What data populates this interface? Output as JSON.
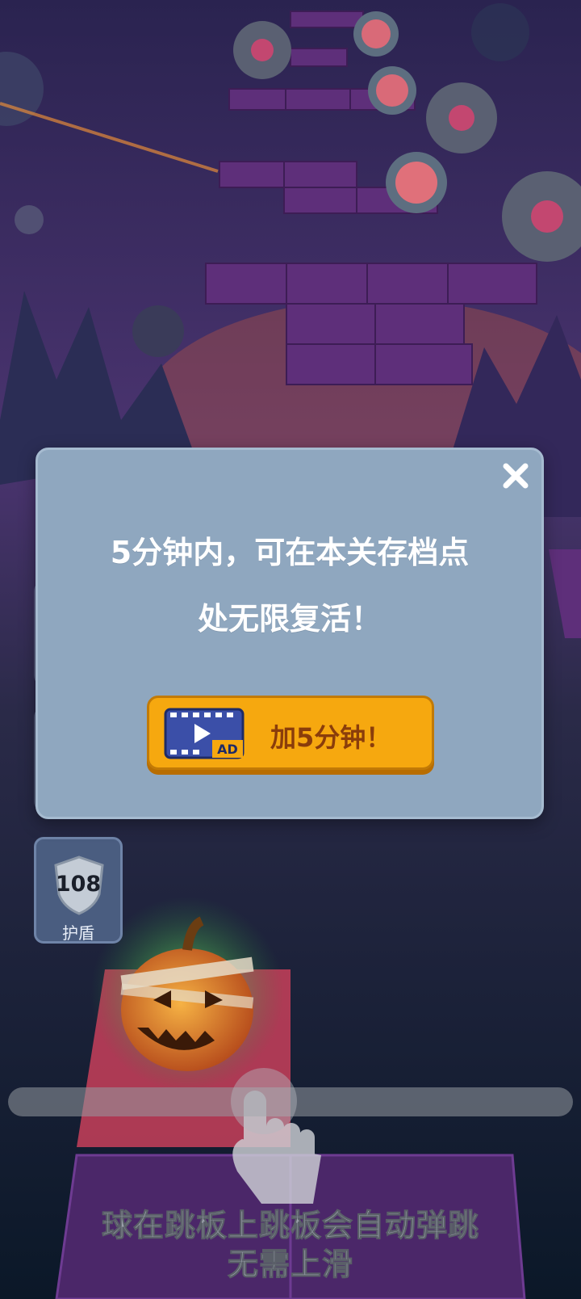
{
  "dialog": {
    "line1": "5分钟内，可在本关存档点",
    "line2": "处无限复活！",
    "ad_button_label": "加5分钟！",
    "ad_icon": "video-ad-icon",
    "ad_badge": "AD",
    "close_icon": "close-icon"
  },
  "shield": {
    "count": "108",
    "label": "护盾",
    "icon": "shield-icon"
  },
  "tutorial": {
    "line1": "球在跳板上跳板会自动弹跳",
    "line2": "无需上滑"
  },
  "colors": {
    "dialog_bg": "#8fa7bf",
    "ad_button": "#f6a80f",
    "ad_label": "#8a3d0b",
    "platform_purple": "#5e2f7a"
  }
}
